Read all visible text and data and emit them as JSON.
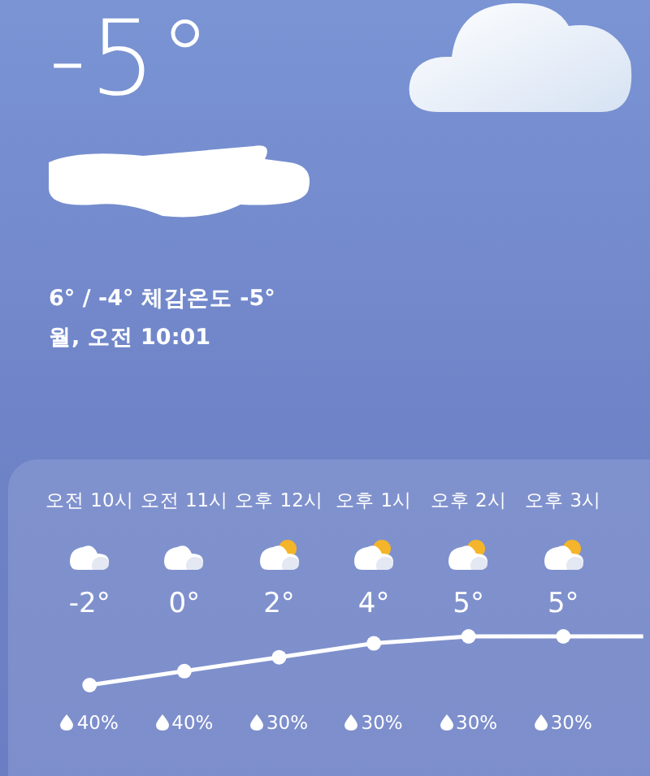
{
  "current": {
    "temperature": "-5°",
    "range_feels_like": "6° / -4° 체감온도 -5°",
    "datetime": "월, 오전 10:01"
  },
  "hourly": [
    {
      "time": "오전 10시",
      "kind": "cloudy",
      "temp": "-2°",
      "precip": "40%"
    },
    {
      "time": "오전 11시",
      "kind": "cloudy",
      "temp": "0°",
      "precip": "40%"
    },
    {
      "time": "오후 12시",
      "kind": "partly-sunny",
      "temp": "2°",
      "precip": "30%"
    },
    {
      "time": "오후 1시",
      "kind": "partly-sunny",
      "temp": "4°",
      "precip": "30%"
    },
    {
      "time": "오후 2시",
      "kind": "partly-sunny",
      "temp": "5°",
      "precip": "30%"
    },
    {
      "time": "오후 3시",
      "kind": "partly-sunny",
      "temp": "5°",
      "precip": "30%"
    }
  ]
}
